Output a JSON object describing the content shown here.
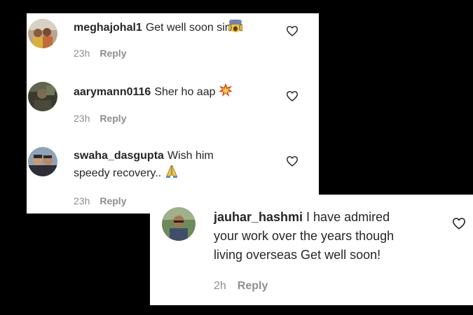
{
  "comments": [
    {
      "username": "meghajohal1",
      "text": "Get well soon sir",
      "emoji": "fearful-face-emoji",
      "time": "23h",
      "reply_label": "Reply"
    },
    {
      "username": "aarymann0116",
      "text": "Sher ho aap",
      "emoji": "collision-emoji",
      "time": "23h",
      "reply_label": "Reply"
    },
    {
      "username": "swaha_dasgupta",
      "text_line1": "Wish him",
      "text_line2": "speedy recovery..",
      "emoji": "folded-hands-emoji",
      "time": "23h",
      "reply_label": "Reply"
    },
    {
      "username": "jauhar_hashmi",
      "text_line1": "I have admired",
      "text_line2": "your work over the years though",
      "text_line3": "living overseas Get well soon!",
      "time": "2h",
      "reply_label": "Reply"
    }
  ],
  "icons": {
    "like": "heart-outline-icon"
  },
  "colors": {
    "background": "#000000",
    "panel": "#ffffff",
    "text": "#262626",
    "meta": "#8e8e8e"
  }
}
